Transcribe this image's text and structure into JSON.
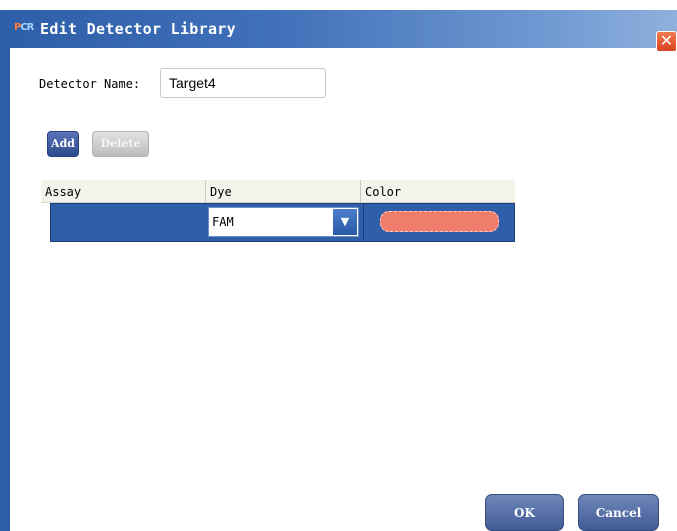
{
  "window": {
    "app_logo": "PCR",
    "title": "Edit Detector Library",
    "close_glyph": "✕"
  },
  "form": {
    "detector_name_label": "Detector Name:",
    "detector_name_value": "Target4"
  },
  "toolbar": {
    "add_label": "Add",
    "delete_label": "Delete",
    "delete_enabled": false
  },
  "grid": {
    "columns": [
      "Assay",
      "Dye",
      "Color"
    ],
    "rows": [
      {
        "assay": "",
        "dye": "FAM",
        "color": "#f07d6c",
        "selected": true
      }
    ]
  },
  "dye_dropdown_icon": "chevron-down-icon",
  "footer": {
    "ok_label": "OK",
    "cancel_label": "Cancel"
  }
}
